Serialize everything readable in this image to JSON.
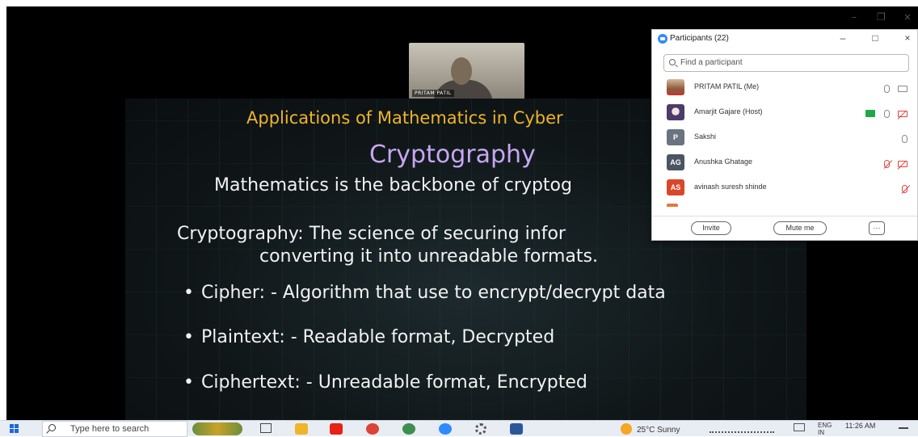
{
  "meeting": {
    "speaker_name": "PRITAM PATIL"
  },
  "slide": {
    "heading": "Applications of Mathematics in Cyber",
    "title": "Cryptography",
    "subtitle": "Mathematics is the backbone of cryptog",
    "definition_line1": "Cryptography: The science of securing infor",
    "definition_line2": "converting it into unreadable formats.",
    "bullets": [
      "Cipher: - Algorithm that use to encrypt/decrypt data",
      "Plaintext: - Readable format, Decrypted",
      "Ciphertext: - Unreadable format, Encrypted"
    ],
    "bullet_symbol": "•"
  },
  "participants_panel": {
    "title": "Participants (22)",
    "search_placeholder": "Find a participant",
    "minimize_symbol": "–",
    "restore_symbol": "□",
    "close_symbol": "×",
    "participants": [
      {
        "name": "PRITAM PATIL (Me)",
        "avatar_type": "photo",
        "mic": "on",
        "video": "on"
      },
      {
        "name": "Amarjit Gajare (Host)",
        "avatar_type": "photo",
        "mic": "on",
        "video": "off",
        "sharing": true
      },
      {
        "name": "Sakshi",
        "avatar_initials": "P",
        "avatar_color": "#6b7280",
        "mic": "on"
      },
      {
        "name": "Anushka Ghatage",
        "avatar_initials": "AG",
        "avatar_color": "#4b5563",
        "mic": "off",
        "video": "off"
      },
      {
        "name": "avinash suresh shinde",
        "avatar_initials": "AS",
        "avatar_color": "#d9472b",
        "mic": "off"
      }
    ],
    "invite_label": "Invite",
    "mute_me_label": "Mute me",
    "more_label": "···"
  },
  "window_controls": {
    "minimize": "–",
    "restore": "❐",
    "close": "×"
  },
  "taskbar": {
    "search_placeholder": "Type here to search",
    "weather": "25°C Sunny",
    "language": "ENG",
    "language_region": "IN",
    "time": "11:26 AM",
    "apps": [
      "task-view",
      "file-explorer",
      "youtube",
      "chrome",
      "chrome-profile",
      "zoom",
      "settings",
      "word"
    ],
    "colors": {
      "youtube": "#e62117",
      "chrome": "#db4437",
      "zoom": "#2d8cff",
      "word": "#2b579a",
      "explorer": "#f0b429",
      "accent": "#1d6ad6"
    }
  }
}
